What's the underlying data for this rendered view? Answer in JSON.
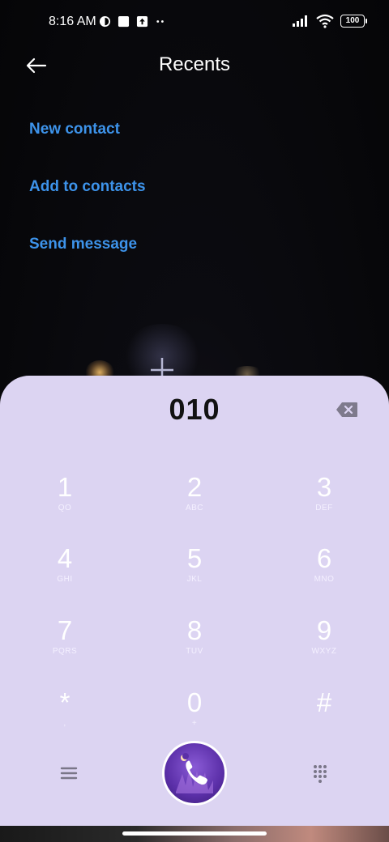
{
  "status_bar": {
    "time": "8:16 AM",
    "battery": "100",
    "icons_left": [
      "ring-icon",
      "square-icon",
      "upload-icon",
      "more-dots-icon"
    ],
    "icons_right": [
      "signal-icon",
      "wifi-icon",
      "battery-icon"
    ]
  },
  "header": {
    "title": "Recents",
    "back_icon": "back-arrow-icon"
  },
  "actions": [
    {
      "label": "New contact"
    },
    {
      "label": "Add to contacts"
    },
    {
      "label": "Send message"
    }
  ],
  "dialer": {
    "number": "010",
    "keys": [
      {
        "digit": "1",
        "letters": "QO"
      },
      {
        "digit": "2",
        "letters": "ABC"
      },
      {
        "digit": "3",
        "letters": "DEF"
      },
      {
        "digit": "4",
        "letters": "GHI"
      },
      {
        "digit": "5",
        "letters": "JKL"
      },
      {
        "digit": "6",
        "letters": "MNO"
      },
      {
        "digit": "7",
        "letters": "PQRS"
      },
      {
        "digit": "8",
        "letters": "TUV"
      },
      {
        "digit": "9",
        "letters": "WXYZ"
      },
      {
        "digit": "*",
        "letters": ","
      },
      {
        "digit": "0",
        "letters": "+"
      },
      {
        "digit": "#",
        "letters": ""
      }
    ]
  },
  "colors": {
    "accent_link": "#3d93ea",
    "sheet_background": "#dcd4f2",
    "call_button": "#5b2fa8"
  }
}
